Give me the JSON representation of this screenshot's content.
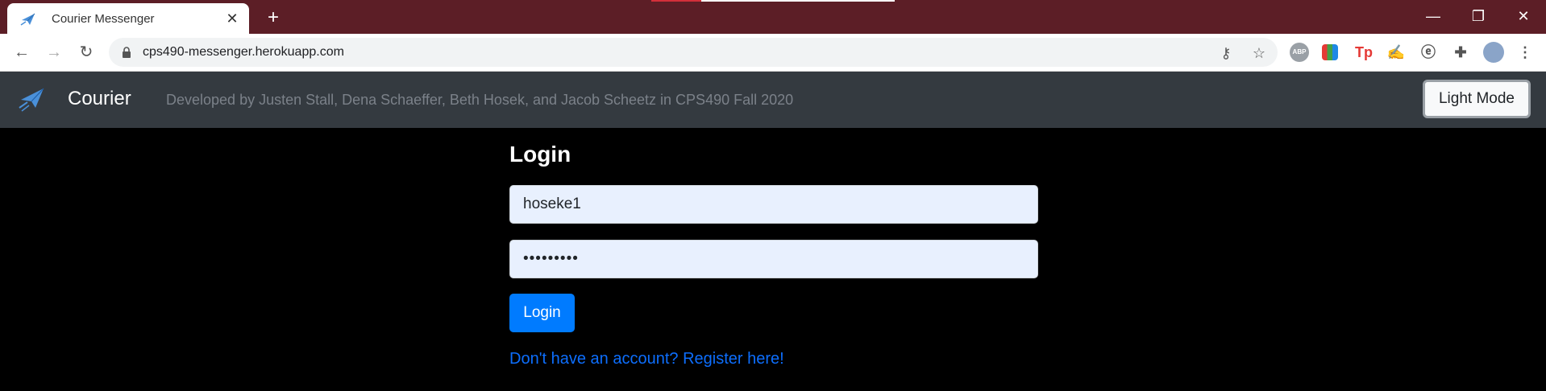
{
  "browser": {
    "tab_title": "Courier Messenger",
    "tab_close": "✕",
    "new_tab": "+",
    "url": "cps490-messenger.herokuapp.com",
    "window_controls": {
      "minimize": "—",
      "restore": "❐",
      "close": "✕"
    },
    "nav": {
      "back": "←",
      "forward": "→",
      "reload": "↻"
    },
    "extensions": [
      {
        "name": "abp-icon",
        "label": "ABP",
        "color": "#9aa0a6"
      },
      {
        "name": "colorful-grid-icon",
        "label": "",
        "color": "#ff9800"
      },
      {
        "name": "tp-icon",
        "label": "Tp",
        "color": "#e53935"
      },
      {
        "name": "hand-icon",
        "label": "✍",
        "color": "#555555"
      },
      {
        "name": "edge-icon",
        "label": "ⓔ",
        "color": "#555555"
      },
      {
        "name": "puzzle-icon",
        "label": "✚",
        "color": "#555555"
      },
      {
        "name": "profile-avatar",
        "label": "",
        "color": "#8aa4c8"
      },
      {
        "name": "menu-icon",
        "label": "⋮",
        "color": "#555555"
      }
    ]
  },
  "navbar": {
    "brand": "Courier",
    "tagline": "Developed by Justen Stall, Dena Schaeffer, Beth Hosek, and Jacob Scheetz in CPS490 Fall 2020",
    "mode_button": "Light Mode"
  },
  "login": {
    "heading": "Login",
    "username_value": "hoseke1",
    "password_value": "•••••••••",
    "submit_label": "Login",
    "register_link": "Don't have an account? Register here!"
  },
  "colors": {
    "titlebar": "#5c1e26",
    "navbar": "#343a40",
    "accent": "#007bff",
    "link": "#0d6efd",
    "background": "#000000"
  }
}
